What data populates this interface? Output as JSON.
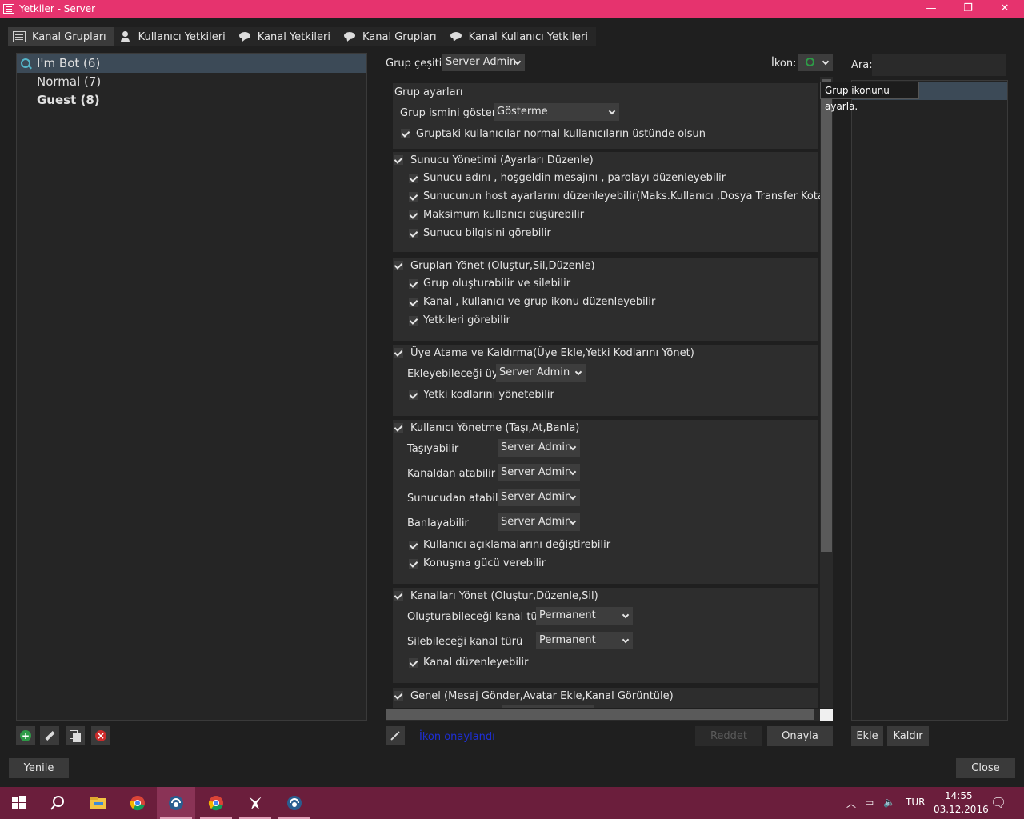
{
  "window": {
    "title": "Yetkiler - Server",
    "minimize": "—",
    "maximize": "❐",
    "close": "✕"
  },
  "tabs": [
    {
      "label": "Kanal Grupları",
      "icon": "server-icon"
    },
    {
      "label": "Kullanıcı Yetkileri",
      "icon": "user-icon"
    },
    {
      "label": "Kanal Yetkileri",
      "icon": "speech-bubble-icon"
    },
    {
      "label": "Kanal Grupları",
      "icon": "speech-bubble-icon"
    },
    {
      "label": "Kanal Kullanıcı Yetkileri",
      "icon": "speech-bubble-icon"
    }
  ],
  "groups": [
    {
      "label": "I'm Bot (6)",
      "icon": "group-icon"
    },
    {
      "label": "Normal (7)"
    },
    {
      "label": "Guest (8)"
    }
  ],
  "group_tools": [
    {
      "name": "add-group",
      "icon": "plus-icon",
      "color": "#2e9b47"
    },
    {
      "name": "rename-group",
      "icon": "pencil-icon"
    },
    {
      "name": "copy-group",
      "icon": "copy-icon"
    },
    {
      "name": "delete-group",
      "icon": "delete-icon",
      "color": "#cc2b2b"
    }
  ],
  "header": {
    "group_type_label": "Grup çeşiti:",
    "group_type_value": "Server Admin",
    "icon_label": "İkon:"
  },
  "permissions": {
    "group_settings": {
      "title": "Grup ayarları",
      "show_name_label": "Grup ismini göster:",
      "show_name_value": "Gösterme",
      "above_normal": "Gruptaki kullanıcılar normal kullanıcıların üstünde olsun"
    },
    "server_admin": {
      "title": "Sunucu Yönetimi (Ayarları Düzenle)",
      "items": [
        "Sunucu adını , hoşgeldin mesajını , parolayı düzenleyebilir",
        "Sunucunun host ayarlarını düzenleyebilir(Maks.Kullanıcı ,Dosya Transfer Kotası vb.)",
        "Maksimum kullanıcı düşürebilir",
        "Sunucu bilgisini görebilir"
      ]
    },
    "group_admin": {
      "title": "Grupları Yönet (Oluştur,Sil,Düzenle)",
      "items": [
        "Grup oluşturabilir ve silebilir",
        "Kanal , kullanıcı ve grup ikonu düzenleyebilir",
        "Yetkileri görebilir"
      ]
    },
    "membership": {
      "title": "Üye Atama ve Kaldırma(Üye Ekle,Yetki Kodlarını Yönet)",
      "add_member_label": "Ekleyebileceği üye",
      "add_member_value": "Server Admin",
      "items": [
        "Yetki kodlarını yönetebilir"
      ]
    },
    "user_admin": {
      "title": "Kullanıcı Yönetme (Taşı,At,Banla)",
      "rows": [
        {
          "label": "Taşıyabilir",
          "value": "Server Admin"
        },
        {
          "label": "Kanaldan atabilir",
          "value": "Server Admin"
        },
        {
          "label": "Sunucudan atabilir",
          "value": "Server Admin"
        },
        {
          "label": "Banlayabilir",
          "value": "Server Admin"
        }
      ],
      "items": [
        "Kullanıcı açıklamalarını değiştirebilir",
        "Konuşma gücü verebilir"
      ]
    },
    "channel_admin": {
      "title": "Kanalları Yönet (Oluştur,Düzenle,Sil)",
      "rows": [
        {
          "label": "Oluşturabileceği kanal türü",
          "value": "Permanent"
        },
        {
          "label": "Silebileceği kanal türü",
          "value": "Permanent"
        }
      ],
      "items": [
        "Kanal düzenleyebilir"
      ]
    },
    "general": {
      "title": "Genel (Mesaj Gönder,Avatar Ekle,Kanal Görüntüle)"
    }
  },
  "footer": {
    "status": "İkon onaylandı",
    "status_color": "#1e2fd6",
    "reject": "Reddet",
    "apply": "Onayla"
  },
  "right_panel": {
    "search_label": "Ara:",
    "search_value": "",
    "tooltip": "Grup ikonunu ayarla.",
    "add": "Ekle",
    "remove": "Kaldır"
  },
  "bottom": {
    "refresh": "Yenile",
    "close": "Close"
  },
  "taskbar": {
    "apps": [
      "start-icon",
      "search-icon",
      "file-explorer-icon",
      "chrome-icon",
      "teamspeak-icon",
      "chrome-icon",
      "app-icon",
      "teamspeak-icon"
    ],
    "lang": "TUR",
    "time": "14:55",
    "date": "03.12.2016"
  }
}
